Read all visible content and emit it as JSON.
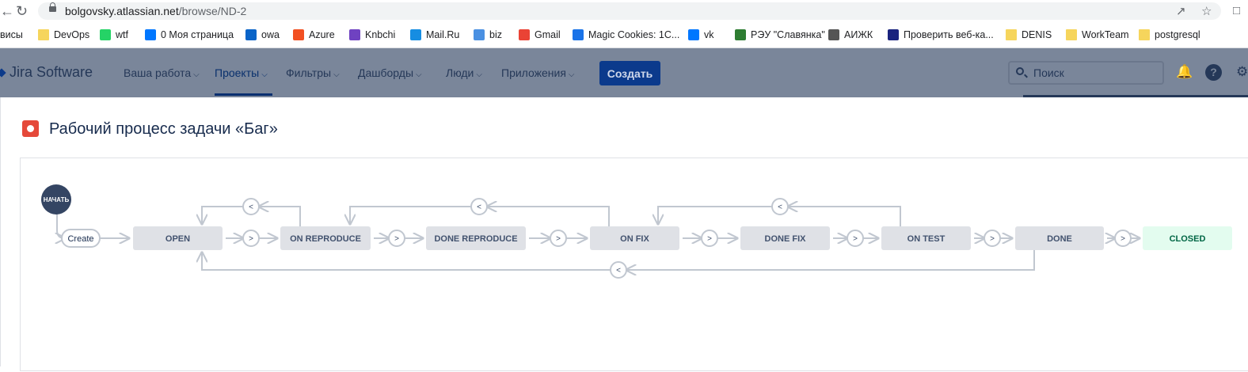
{
  "browser": {
    "url_host": "bolgovsky.atlassian.net",
    "url_path": "/browse/ND-2",
    "bookmarks": [
      {
        "label": "висы",
        "icon": "generic"
      },
      {
        "label": "DevOps",
        "icon": "folder"
      },
      {
        "label": "wtf",
        "icon": "whatsapp-icon",
        "color": "#25d366"
      },
      {
        "label": "0 Моя страница",
        "icon": "vk-icon",
        "color": "#0077ff"
      },
      {
        "label": "owa",
        "icon": "outlook-icon",
        "color": "#0a64c8"
      },
      {
        "label": "Azure",
        "icon": "microsoft-icon",
        "color": "#f25022"
      },
      {
        "label": "Knbchi",
        "icon": "k-icon",
        "color": "#6f42c1"
      },
      {
        "label": "Mail.Ru",
        "icon": "mailru-icon",
        "color": "#168de2"
      },
      {
        "label": "biz",
        "icon": "biz-icon",
        "color": "#4a90e2"
      },
      {
        "label": "Gmail",
        "icon": "gmail-icon",
        "color": "#ea4335"
      },
      {
        "label": "Magic Cookies: 1C...",
        "icon": "cookie-icon",
        "color": "#1a73e8"
      },
      {
        "label": "vk",
        "icon": "vk-icon",
        "color": "#0077ff"
      },
      {
        "label": "РЭУ \"Славянка\"",
        "icon": "slav-icon",
        "color": "#2e7d32"
      },
      {
        "label": "АИЖК",
        "icon": "globe-icon",
        "color": "#555555"
      },
      {
        "label": "Проверить веб-ка...",
        "icon": "check-icon",
        "color": "#1a237e"
      },
      {
        "label": "DENIS",
        "icon": "folder"
      },
      {
        "label": "WorkTeam",
        "icon": "folder"
      },
      {
        "label": "postgresql",
        "icon": "folder"
      }
    ]
  },
  "jira": {
    "logo": "Jira Software",
    "nav": [
      {
        "label": "Ваша работа",
        "active": false
      },
      {
        "label": "Проекты",
        "active": true
      },
      {
        "label": "Фильтры",
        "active": false
      },
      {
        "label": "Дашборды",
        "active": false
      },
      {
        "label": "Люди",
        "active": false
      },
      {
        "label": "Приложения",
        "active": false
      }
    ],
    "create_label": "Создать",
    "search_placeholder": "Поиск",
    "help_label": "?"
  },
  "modal": {
    "title": "Рабочий процесс задачи «Баг»",
    "start_label": "НАЧАТЬ",
    "create_label": "Create",
    "statuses": [
      "OPEN",
      "ON REPRODUCE",
      "DONE REPRODUCE",
      "ON FIX",
      "DONE FIX",
      "ON TEST",
      "DONE",
      "CLOSED"
    ],
    "forward_label": ">",
    "back_label": "<",
    "colors": {
      "status_bg": "#dfe1e6",
      "closed_bg": "#e3fcef",
      "line": "#c1c7d0",
      "start": "#344563"
    }
  }
}
